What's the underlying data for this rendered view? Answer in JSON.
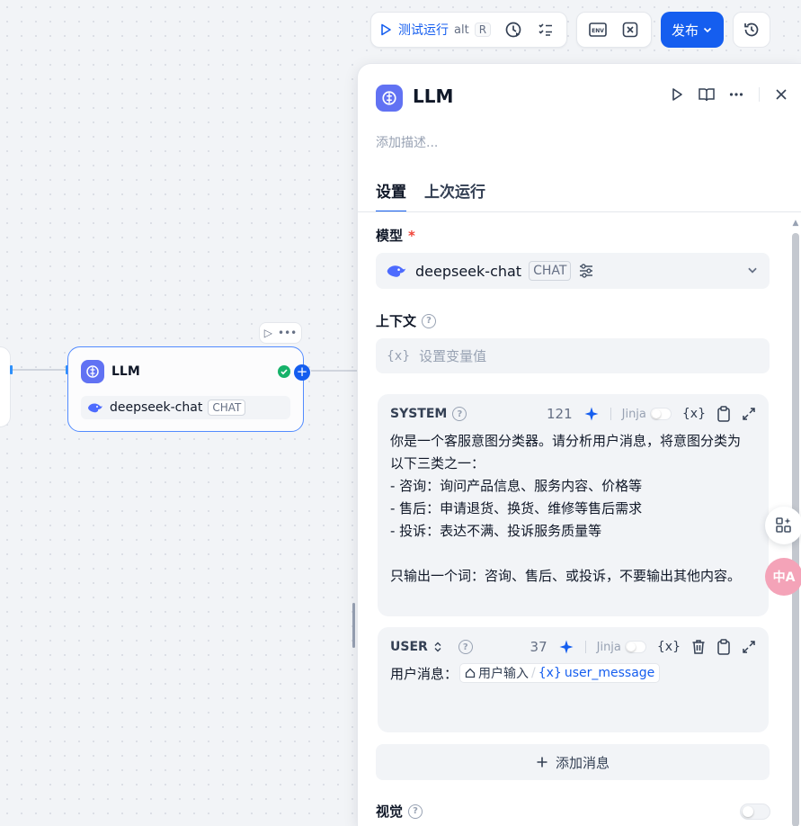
{
  "toolbar": {
    "run_label": "测试运行",
    "shortcut_alt": "alt",
    "shortcut_key": "R",
    "env_label": "ENV",
    "publish_label": "发布"
  },
  "canvas": {
    "node": {
      "title": "LLM",
      "model": "deepseek-chat",
      "mode_tag": "CHAT"
    }
  },
  "panel": {
    "title": "LLM",
    "description_placeholder": "添加描述...",
    "tabs": [
      {
        "label": "设置",
        "active": true
      },
      {
        "label": "上次运行",
        "active": false
      }
    ],
    "model": {
      "label": "模型",
      "required_mark": "*",
      "name": "deepseek-chat",
      "mode_tag": "CHAT"
    },
    "context": {
      "label": "上下文",
      "var_icon": "{x}",
      "placeholder": "设置变量值"
    },
    "system_message": {
      "role": "SYSTEM",
      "count": "121",
      "jinja": "Jinja",
      "var_icon": "{x}",
      "text": "你是一个客服意图分类器。请分析用户消息，将意图分类为以下三类之一：\n- 咨询：询问产品信息、服务内容、价格等\n- 售后：申请退货、换货、维修等售后需求\n- 投诉：表达不满、投诉服务质量等\n\n只输出一个词：咨询、售后、或投诉，不要输出其他内容。"
    },
    "user_message": {
      "role": "USER",
      "count": "37",
      "jinja": "Jinja",
      "var_icon": "{x}",
      "prefix": "用户消息：",
      "var_source": "用户输入",
      "var_separator": "/",
      "var_name": "user_message"
    },
    "add_message_label": "添加消息",
    "vision": {
      "label": "视觉"
    }
  },
  "floating": {
    "translate_label": "中A"
  },
  "colors": {
    "accent": "#155eef",
    "node_badge": "#6172f3",
    "success": "#17b26a",
    "required": "#f04438"
  }
}
